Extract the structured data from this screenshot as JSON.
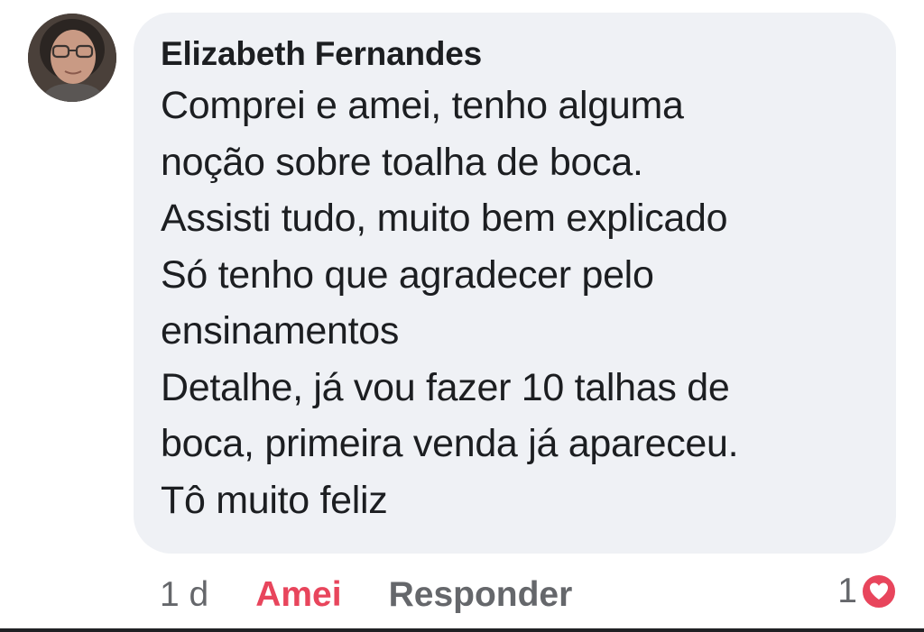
{
  "comment": {
    "author": "Elizabeth Fernandes",
    "avatar_icon": "profile-photo",
    "lines": [
      "Comprei e amei, tenho alguma",
      "noção sobre toalha de boca.",
      "Assisti tudo, muito bem explicado",
      "Só tenho que agradecer pelo",
      "ensinamentos",
      "Detalhe, já vou fazer 10 talhas de",
      "boca, primeira venda já apareceu.",
      "Tô muito feliz"
    ],
    "timestamp": "1 d",
    "react_label": "Amei",
    "reply_label": "Responder",
    "reaction_count": "1",
    "reaction_icon": "heart-icon"
  },
  "colors": {
    "bubble": "#eff1f5",
    "text": "#1c1e21",
    "muted": "#65676b",
    "love": "#e8455c"
  }
}
